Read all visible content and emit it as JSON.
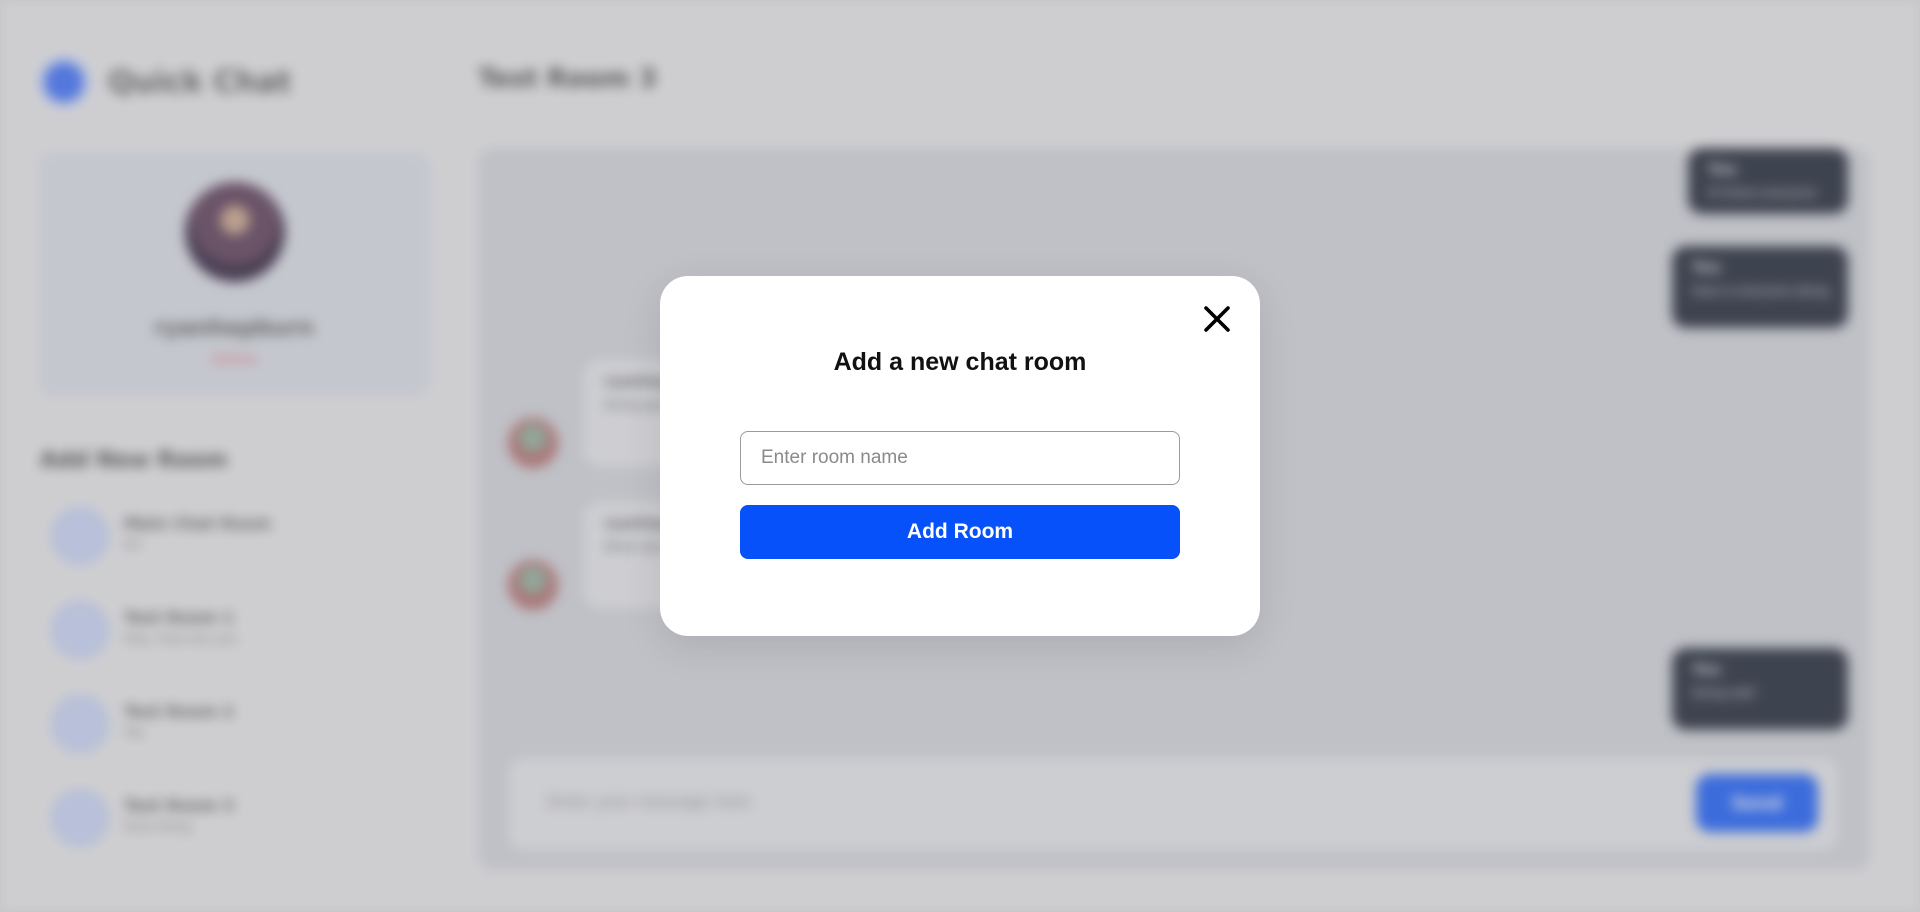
{
  "brand": {
    "name": "Quick Chat"
  },
  "profile": {
    "name": "ryanhepburn",
    "status": "Online"
  },
  "sidebar": {
    "heading": "Add New Room",
    "rooms": [
      {
        "name": "Main Chat Room",
        "last": "Hi!"
      },
      {
        "name": "Test Room 1",
        "last": "Hey, how are you"
      },
      {
        "name": "Test Room 2",
        "last": "Yes"
      },
      {
        "name": "Test Room 3",
        "last": "Sure thing"
      }
    ]
  },
  "chat": {
    "title": "Test Room 3",
    "messages": [
      {
        "direction": "out",
        "sender": "You",
        "text": "Hi there everyone",
        "time": ""
      },
      {
        "direction": "out",
        "sender": "You",
        "text": "How is everyone doing",
        "time": ""
      },
      {
        "direction": "in",
        "sender": "ryanhep",
        "text": "Doing good",
        "time": ""
      },
      {
        "direction": "in",
        "sender": "ryanhep",
        "text": "What about you",
        "time": ""
      },
      {
        "direction": "out",
        "sender": "You",
        "text": "Doing well",
        "time": ""
      }
    ],
    "composer_placeholder": "Enter your message here",
    "send_label": "Send"
  },
  "modal": {
    "title": "Add a new chat room",
    "input_placeholder": "Enter room name",
    "input_value": "",
    "submit_label": "Add Room",
    "close_icon": "close-icon"
  },
  "colors": {
    "accent": "#0751fb",
    "modal_bg": "#ffffff",
    "dark_bubble": "#1d2433",
    "backdrop": "#d6d6d8"
  }
}
